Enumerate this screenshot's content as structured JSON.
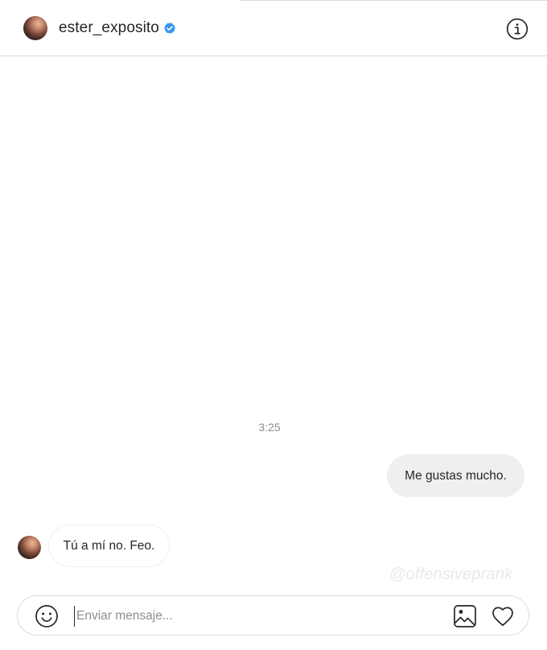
{
  "header": {
    "username": "ester_exposito",
    "verified": true,
    "verified_color": "#3897f0",
    "info_icon": "info-icon"
  },
  "conversation": {
    "timestamp": "3:25",
    "messages": [
      {
        "direction": "outgoing",
        "text": "Me gustas mucho."
      },
      {
        "direction": "incoming",
        "text": "Tú a mí no. Feo."
      }
    ]
  },
  "watermark": "@offensiveprank",
  "composer": {
    "placeholder": "Enviar mensaje...",
    "value": "",
    "icons": [
      "emoji-icon",
      "image-icon",
      "heart-icon"
    ]
  },
  "colors": {
    "outgoing_bubble": "#efefef",
    "border": "#dbdbdb",
    "muted_text": "#8e8e8e"
  }
}
